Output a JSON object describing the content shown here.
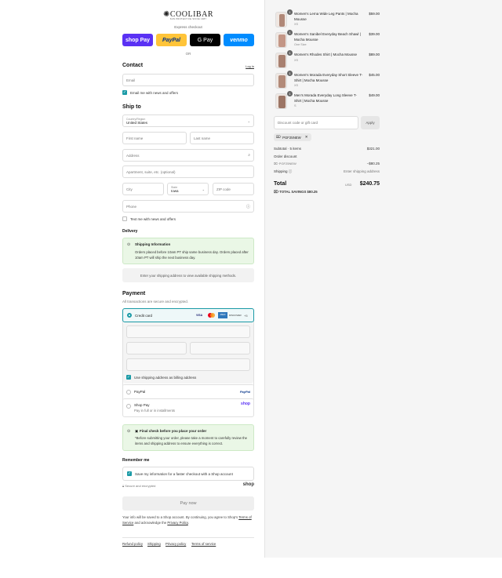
{
  "brand": {
    "logo_text": "COOLIBAR",
    "tagline": "SUN PROTECTIVE SINCE 1987"
  },
  "express": {
    "label": "Express checkout",
    "buttons": [
      "shop Pay",
      "PayPal",
      "G Pay",
      "venmo"
    ],
    "or": "OR"
  },
  "contact": {
    "title": "Contact",
    "login": "Log in",
    "email_placeholder": "Email",
    "news_label": "Email me with news and offers"
  },
  "ship": {
    "title": "Ship to",
    "country_label": "Country/Region",
    "country_value": "United States",
    "first": "First name",
    "last": "Last name",
    "address": "Address",
    "apt": "Apartment, suite, etc. (optional)",
    "city": "City",
    "state_label": "State",
    "state_value": "Iowa",
    "zip": "ZIP code",
    "phone": "Phone",
    "text_label": "Text me with news and offers"
  },
  "delivery": {
    "title": "Delivery",
    "info_title": "Shipping Information",
    "info_body": "Orders placed before 10am PT ship same business day. Orders placed after 10am PT will ship the next business day.",
    "placeholder": "Enter your shipping address to view available shipping methods."
  },
  "payment": {
    "title": "Payment",
    "subtitle": "All transactions are secure and encrypted.",
    "credit_card": "Credit card",
    "card_icons": [
      "visa-icon",
      "mastercard-icon",
      "amex-icon",
      "discover-icon"
    ],
    "more": "+5",
    "billing_label": "Use shipping address as billing address",
    "paypal": "PayPal",
    "paypal_logo": "PayPal",
    "shoppay": "Shop Pay",
    "shoppay_sub": "Pay in full or in installments",
    "shoppay_logo": "shop"
  },
  "final": {
    "title": "Final check before you place your order",
    "body": "*Before submitting your order, please take a moment to carefully review the items and shipping address to ensure everything is correct."
  },
  "remember": {
    "title": "Remember me",
    "label": "Save my information for a faster checkout with a Shop account",
    "secure": "Secure and encrypted",
    "shop_logo": "shop"
  },
  "pay_button": "Pay now",
  "legal": {
    "text_a": "Your info will be saved to a Shop account. By continuing, you agree to Shop's ",
    "tos": "Terms of Service",
    "text_b": " and acknowledge the ",
    "privacy": "Privacy Policy",
    "text_c": "."
  },
  "footer_links": [
    "Refund policy",
    "Shipping",
    "Privacy policy",
    "Terms of service"
  ],
  "cart": {
    "items": [
      {
        "name": "Women's Lerna Wide Leg Pants | Mocha Mousse",
        "variant": "XS",
        "price": "$59.00",
        "qty": "1"
      },
      {
        "name": "Women's Sanibel Everyday Beach Shawl | Mocha Mousse",
        "variant": "One Size",
        "price": "$39.00",
        "qty": "1"
      },
      {
        "name": "Women's Rhodes Shirt | Mocha Mousse",
        "variant": "XS",
        "price": "$89.00",
        "qty": "1"
      },
      {
        "name": "Women's Morada Everyday Short Sleeve T-Shirt | Mocha Mousse",
        "variant": "XS",
        "price": "$45.00",
        "qty": "1"
      },
      {
        "name": "Men's Morada Everyday Long Sleeve T-Shirt | Mocha Mousse",
        "variant": "S",
        "price": "$49.00",
        "qty": "1"
      }
    ],
    "discount_placeholder": "Discount code or gift card",
    "apply": "Apply",
    "code_tag": "PGF25NEW",
    "subtotal_label": "Subtotal · 5 items",
    "subtotal": "$321.00",
    "order_discount": "Order discount",
    "discount_code": "PGF25NEW",
    "discount_amount": "−$80.25",
    "shipping_label": "Shipping",
    "shipping_value": "Enter shipping address",
    "total_label": "Total",
    "currency": "USD",
    "total": "$240.75",
    "savings_label": "TOTAL SAVINGS",
    "savings": "$80.25"
  }
}
